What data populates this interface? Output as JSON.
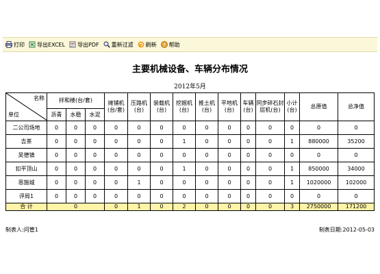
{
  "toolbar": {
    "print": "打印",
    "export_excel": "导出EXCEL",
    "export_pdf": "导出PDF",
    "refilter": "重新过滤",
    "refresh": "刷新",
    "help": "帮助"
  },
  "report": {
    "title": "主要机械设备、车辆分布情况",
    "date": "2012年5月"
  },
  "table": {
    "corner_top": "名称",
    "corner_bottom": "单位",
    "group_mixer": "拌和楼(台/套)",
    "sub_asphalt": "沥青",
    "sub_stabilized": "水稳",
    "sub_cement": "水泥",
    "col_paver": "摊铺机(台/套)",
    "col_roller": "压路机(台)",
    "col_loader": "装载机(台)",
    "col_excavator": "挖掘机(台)",
    "col_bulldozer": "推土机(台)",
    "col_grader": "平地机(台)",
    "col_vehicle": "车辆(台)",
    "col_chip_sealer": "同步碎石封层机(台)",
    "col_subtotal": "小计(台)",
    "col_original_value": "总原值",
    "col_net_value": "总净值",
    "rows": [
      {
        "unit": "二公司场地",
        "v": [
          "0",
          "0",
          "0",
          "0",
          "0",
          "0",
          "0",
          "0",
          "0",
          "0",
          "0",
          "0",
          "0",
          "0"
        ]
      },
      {
        "unit": "吉茶",
        "v": [
          "0",
          "0",
          "0",
          "0",
          "0",
          "0",
          "1",
          "0",
          "0",
          "0",
          "0",
          "1",
          "880000",
          "35200"
        ]
      },
      {
        "unit": "吴德镇",
        "v": [
          "0",
          "0",
          "0",
          "0",
          "0",
          "0",
          "0",
          "0",
          "0",
          "0",
          "0",
          "0",
          "0",
          "0"
        ]
      },
      {
        "unit": "扣平顶山",
        "v": [
          "0",
          "0",
          "0",
          "0",
          "0",
          "0",
          "1",
          "0",
          "0",
          "0",
          "0",
          "1",
          "850000",
          "34000"
        ]
      },
      {
        "unit": "恩施城",
        "v": [
          "0",
          "0",
          "0",
          "0",
          "1",
          "0",
          "0",
          "0",
          "0",
          "0",
          "0",
          "1",
          "1020000",
          "102000"
        ]
      },
      {
        "unit": "评局1",
        "v": [
          "0",
          "0",
          "0",
          "0",
          "0",
          "0",
          "0",
          "0",
          "0",
          "0",
          "0",
          "0",
          "0",
          "0"
        ]
      }
    ],
    "total": {
      "label": "合  计",
      "mixer_total": "0",
      "v": [
        "0",
        "1",
        "0",
        "2",
        "0",
        "0",
        "0",
        "0",
        "3",
        "2750000",
        "171200"
      ]
    }
  },
  "footer": {
    "maker": "制表人:问管1",
    "make_date": "制表日期:2012-05-03"
  },
  "colors": {
    "toolbar_bg": "#fbf7d9",
    "total_row_bg": "#fff3a8"
  }
}
